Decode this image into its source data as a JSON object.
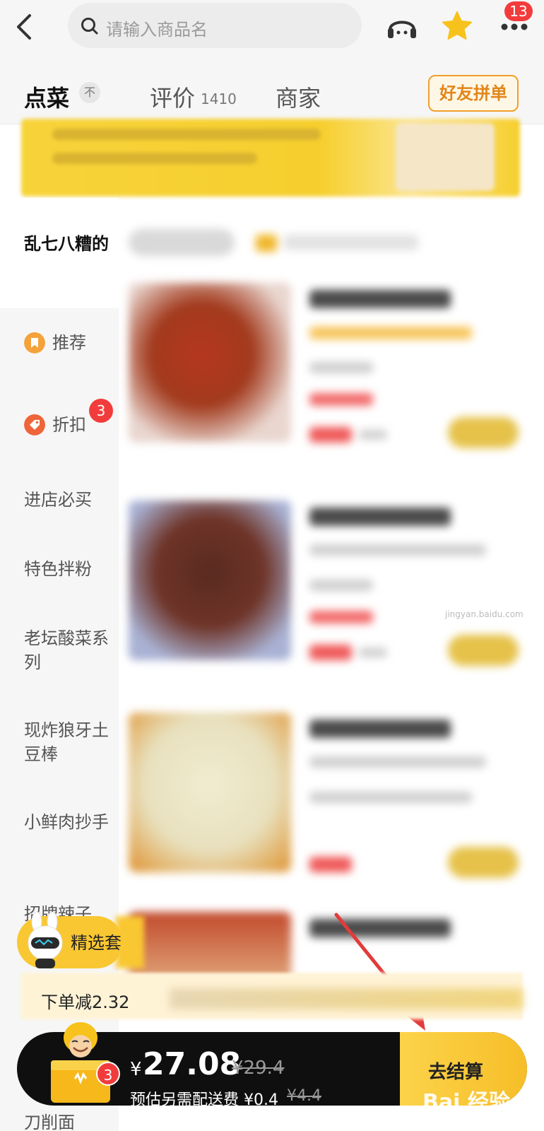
{
  "header": {
    "search_placeholder": "请输入商品名",
    "more_badge": "13"
  },
  "tabs": {
    "menu": "点菜",
    "top_marker": "不",
    "review": "评价",
    "review_count": "1410",
    "merchant": "商家",
    "group_order": "好友拼单"
  },
  "sidebar": {
    "items": [
      {
        "label": "乱七八糟的",
        "active": true
      },
      {
        "label": "推荐",
        "icon": "bookmark-icon"
      },
      {
        "label": "折扣",
        "icon": "discount-tag-icon",
        "badge": "3"
      },
      {
        "label": "进店必买"
      },
      {
        "label": "特色拌粉"
      },
      {
        "label": "老坛酸菜系列"
      },
      {
        "label": "现炸狼牙土豆棒"
      },
      {
        "label": "小鲜肉抄手"
      },
      {
        "label": "招牌辣子"
      },
      {
        "label": "刀削面"
      }
    ]
  },
  "promo": {
    "label": "精选套"
  },
  "discount": {
    "text": "下单减2.32"
  },
  "cart": {
    "badge": "3",
    "currency": "¥",
    "price": "27.08",
    "original_price": "¥29.4",
    "fee_text": "预估另需配送费 ¥0.4",
    "fee_original": "¥4.4",
    "checkout_label": "去结算"
  },
  "watermark": {
    "text": "Bai 经验",
    "url": "jingyan.baidu.com"
  },
  "colors": {
    "accent": "#f9c732",
    "badge": "#f23c3c",
    "group_btn": "#e1861a"
  }
}
